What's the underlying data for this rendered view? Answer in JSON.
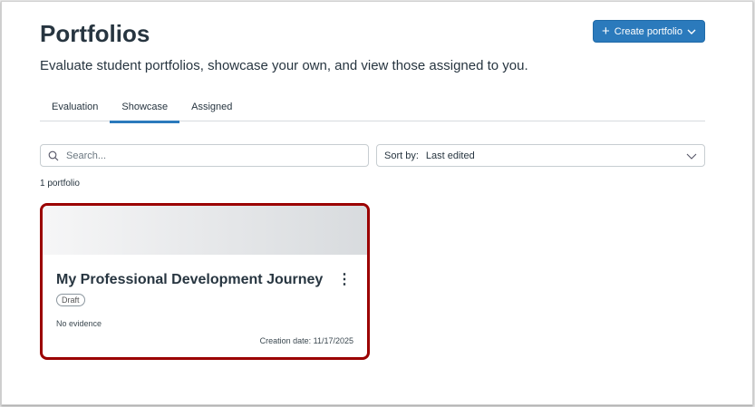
{
  "page": {
    "title": "Portfolios",
    "subtitle": "Evaluate student portfolios, showcase your own, and view those assigned to you."
  },
  "create_button": {
    "label": "Create portfolio"
  },
  "tabs": [
    {
      "label": "Evaluation"
    },
    {
      "label": "Showcase",
      "active": true
    },
    {
      "label": "Assigned"
    }
  ],
  "search": {
    "placeholder": "Search...",
    "value": ""
  },
  "sort": {
    "label": "Sort by:",
    "value": "Last edited"
  },
  "count": "1 portfolio",
  "cards": [
    {
      "title": "My Professional Development Journey",
      "status": "Draft",
      "evidence": "No evidence",
      "creation_date": "Creation date: 11/17/2025"
    }
  ],
  "colors": {
    "accent": "#2b7abc",
    "highlight": "#9b0000"
  }
}
